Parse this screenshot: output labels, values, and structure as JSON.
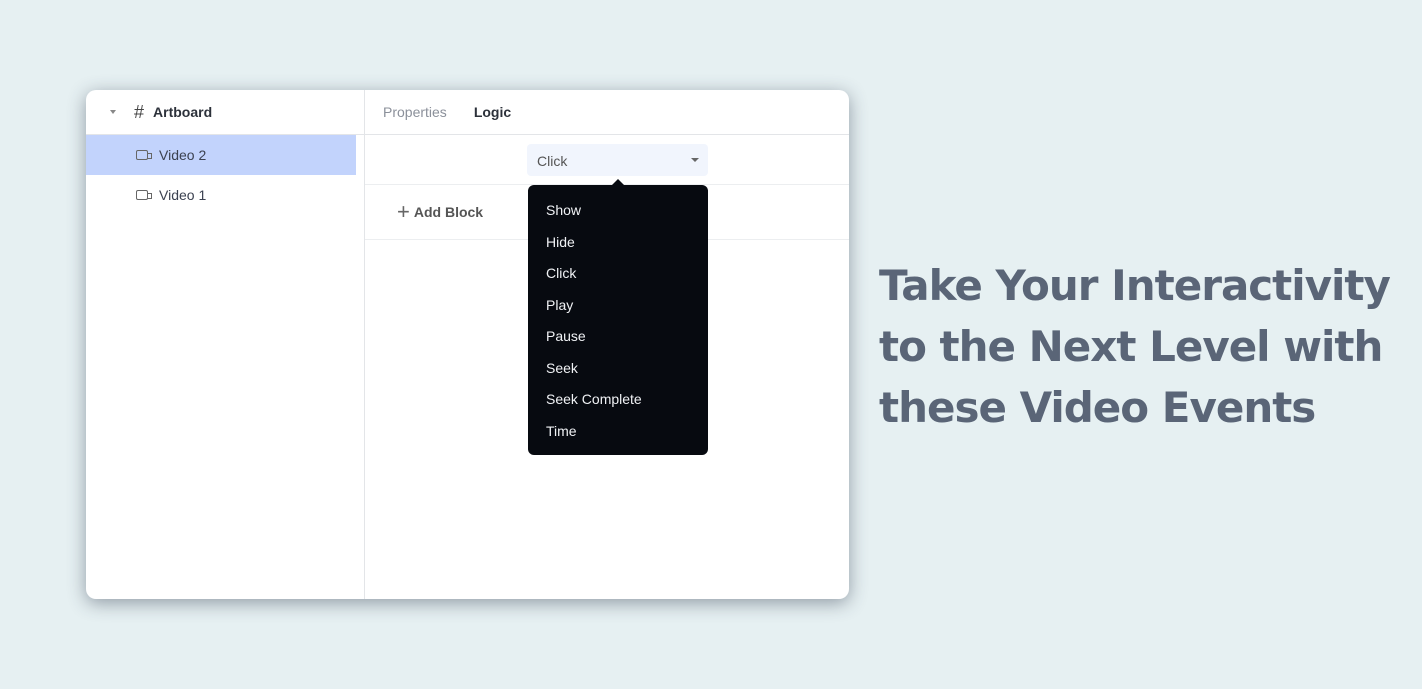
{
  "sidebar": {
    "root": "Artboard",
    "items": [
      {
        "label": "Video 2",
        "selected": true
      },
      {
        "label": "Video 1",
        "selected": false
      }
    ]
  },
  "tabs": [
    {
      "label": "Properties",
      "active": false
    },
    {
      "label": "Logic",
      "active": true
    }
  ],
  "event_select": {
    "value": "Click"
  },
  "add_block": "Add Block",
  "menu": [
    "Show",
    "Hide",
    "Click",
    "Play",
    "Pause",
    "Seek",
    "Seek Complete",
    "Time"
  ],
  "headline": [
    "Take Your Interactivity",
    "to the Next Level with",
    "these Video Events"
  ],
  "colors": {
    "selected": "#c2d3fc",
    "menu_bg": "#070a10",
    "background": "#e6f0f2",
    "headline": "#5a6577"
  }
}
